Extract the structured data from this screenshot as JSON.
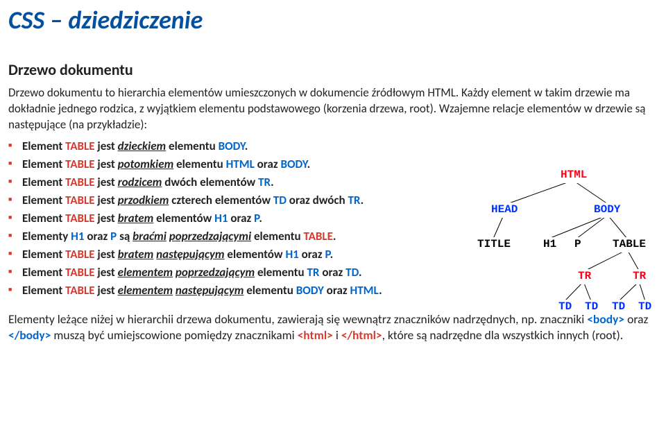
{
  "title": "CSS – dziedziczenie",
  "subtitle": "Drzewo dokumentu",
  "intro": "Drzewo dokumentu to hierarchia elementów umieszczonych w dokumencie źródłowym HTML. Każdy element w takim drzewie ma dokładnie jednego rodzica, z wyjątkiem elementu podstawowego (korzenia drzewa, root). Wzajemne relacje elementów w drzewie są następujące (na przykładzie):",
  "bullets": {
    "b1_pre": "Element ",
    "b1_r1": "TABLE",
    "b1_mid": " jest ",
    "b1_u1": "dzieckiem",
    "b1_aft1": " elementu ",
    "b1_bl1": "BODY",
    "b1_end": ".",
    "b2_pre": "Element ",
    "b2_r1": "TABLE",
    "b2_mid": " jest ",
    "b2_u1": "potomkiem",
    "b2_aft1": " elementu ",
    "b2_bl1": "HTML",
    "b2_aft2": " oraz ",
    "b2_bl2": "BODY",
    "b2_end": ".",
    "b3_pre": "Element ",
    "b3_r1": "TABLE",
    "b3_mid": " jest ",
    "b3_u1": "rodzicem",
    "b3_aft1": " dwóch elementów ",
    "b3_bl1": "TR",
    "b3_end": ".",
    "b4_pre": "Element ",
    "b4_r1": "TABLE",
    "b4_mid": " jest ",
    "b4_u1": "przodkiem",
    "b4_aft1": " czterech elementów ",
    "b4_bl1": "TD",
    "b4_aft2": " oraz dwóch ",
    "b4_bl2": "TR",
    "b4_end": ".",
    "b5_pre": "Element ",
    "b5_r1": "TABLE",
    "b5_mid": " jest ",
    "b5_u1": "bratem",
    "b5_aft1": " elementów ",
    "b5_bl1": "H1",
    "b5_aft2": " oraz ",
    "b5_bl2": "P",
    "b5_end": ".",
    "b6_pre": "Elementy ",
    "b6_bl1": "H1",
    "b6_mid1": " oraz ",
    "b6_bl2": "P",
    "b6_mid2": " są ",
    "b6_u1": "braćmi",
    "b6_u2": "poprzedzającymi",
    "b6_aft1": " elementu ",
    "b6_r1": "TABLE",
    "b6_end": ".",
    "b7_pre": "Element ",
    "b7_r1": "TABLE",
    "b7_mid": " jest ",
    "b7_u1": "bratem",
    "b7_u2": "następującym",
    "b7_aft1": " elementów ",
    "b7_bl1": "H1",
    "b7_aft2": " oraz ",
    "b7_bl2": "P",
    "b7_end": ".",
    "b8_pre": "Element ",
    "b8_r1": "TABLE",
    "b8_mid": " jest ",
    "b8_u1": "elementem",
    "b8_u2": "poprzedzającym",
    "b8_aft1": " elementu ",
    "b8_bl1": "TR",
    "b8_aft2": " oraz ",
    "b8_bl2": "TD",
    "b8_end": ".",
    "b9_pre": "Element ",
    "b9_r1": "TABLE",
    "b9_mid": " jest ",
    "b9_u1": "elementem",
    "b9_u2": "następującym",
    "b9_aft1": " elementu ",
    "b9_bl1": "BODY",
    "b9_aft2": " oraz ",
    "b9_bl2": "HTML",
    "b9_end": "."
  },
  "bottom": {
    "t1": "Elementy leżące niżej w hierarchii drzewa dokumentu, zawierają się wewnątrz znaczników nadrzędnych, np. znaczniki ",
    "tag1": "<body>",
    "t2": " oraz ",
    "tag2": "</body>",
    "t3": " muszą być umiejscowione pomiędzy znacznikami ",
    "tag3": "<html>",
    "t4": " i ",
    "tag4": "</html>",
    "t5": ", które są nadrzędne dla wszystkich innych (root)."
  },
  "tree": {
    "html": "HTML",
    "head": "HEAD",
    "body": "BODY",
    "title": "TITLE",
    "h1": "H1",
    "p": "P",
    "table": "TABLE",
    "tr": "TR",
    "td": "TD"
  }
}
